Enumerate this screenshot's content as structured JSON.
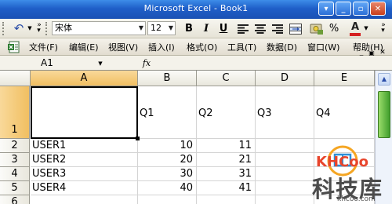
{
  "window": {
    "title": "Microsoft Excel - Book1",
    "buttons": [
      "help",
      "minimize",
      "maximize",
      "close"
    ]
  },
  "toolbar": {
    "font_name": "宋体",
    "font_size": "12",
    "bold_label": "B",
    "italic_label": "I",
    "underline_label": "U",
    "percent_label": "%",
    "font_color_label": "A",
    "accent_font_color": "#d42020"
  },
  "menu": {
    "items": [
      "文件(F)",
      "编辑(E)",
      "视图(V)",
      "插入(I)",
      "格式(O)",
      "工具(T)",
      "数据(D)",
      "窗口(W)",
      "帮助(H)"
    ]
  },
  "formula_bar": {
    "name_box": "A1",
    "fx_label": "fx",
    "formula": ""
  },
  "sheet": {
    "columns": [
      "A",
      "B",
      "C",
      "D",
      "E"
    ],
    "rows": [
      "1",
      "2",
      "3",
      "4",
      "5",
      "6"
    ],
    "header_row": [
      "",
      "Q1",
      "Q2",
      "Q3",
      "Q4"
    ],
    "data_rows": [
      [
        "USER1",
        "10",
        "11"
      ],
      [
        "USER2",
        "20",
        "21"
      ],
      [
        "USER3",
        "30",
        "31"
      ],
      [
        "USER4",
        "40",
        "41"
      ]
    ]
  },
  "watermark": {
    "logo": "KHCoo",
    "name": "科技库",
    "url": "khcoo.com",
    "colors": [
      "#e8452c",
      "#f5a623",
      "#2f8fd8"
    ]
  }
}
